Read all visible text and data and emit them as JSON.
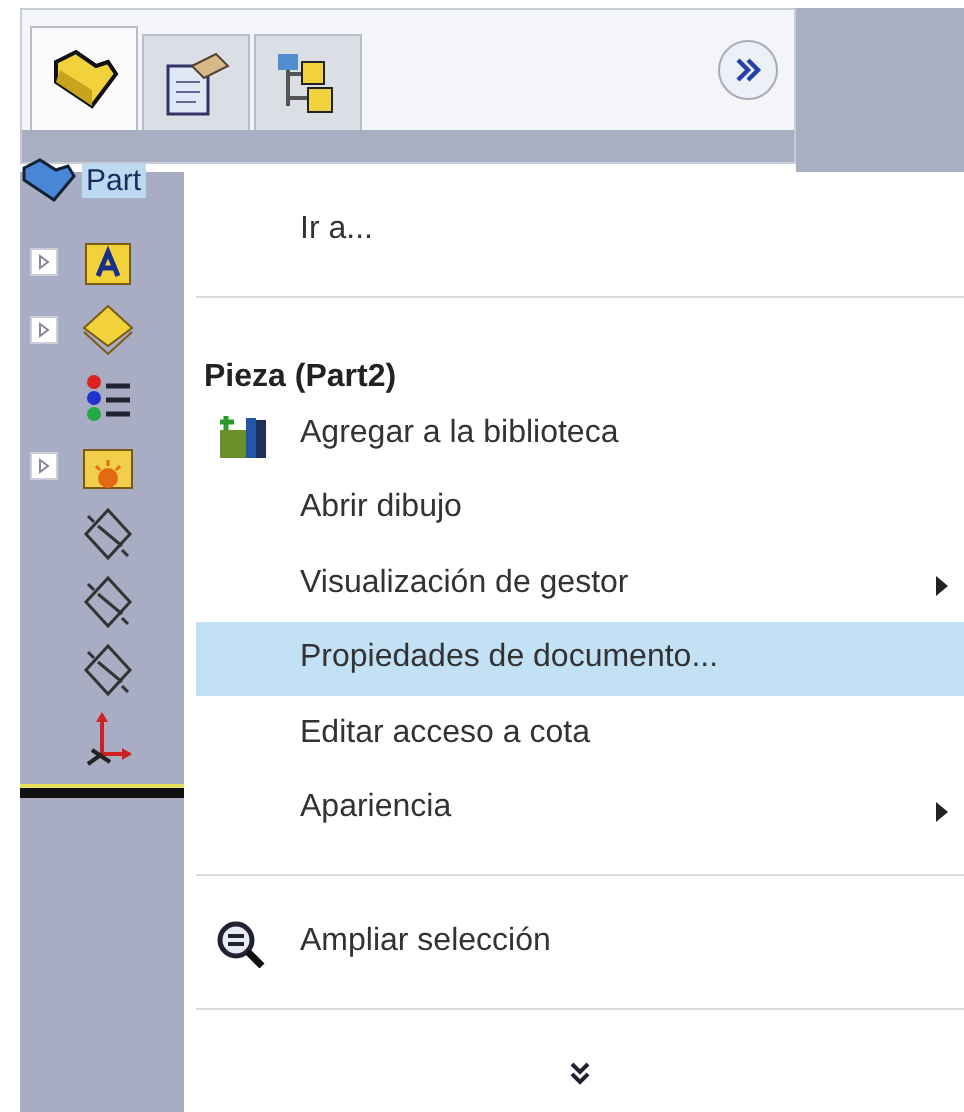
{
  "tabs": [
    {
      "selected": true
    },
    {
      "selected": false
    },
    {
      "selected": false
    }
  ],
  "tree": {
    "root": {
      "label": "Part"
    },
    "items": [
      {
        "expandable": true
      },
      {
        "expandable": true
      },
      {
        "expandable": false
      },
      {
        "expandable": true
      },
      {
        "expandable": false
      },
      {
        "expandable": false
      },
      {
        "expandable": false
      },
      {
        "expandable": false
      }
    ]
  },
  "menu": {
    "items": [
      {
        "kind": "item",
        "label": "Ir a...",
        "selected": false,
        "submenu": false,
        "has_icon": false
      },
      {
        "kind": "divider"
      },
      {
        "kind": "header",
        "label": "Pieza (Part2)"
      },
      {
        "kind": "item",
        "label": "Agregar a la biblioteca",
        "selected": false,
        "submenu": false,
        "has_icon": true
      },
      {
        "kind": "item",
        "label": "Abrir dibujo",
        "selected": false,
        "submenu": false,
        "has_icon": false
      },
      {
        "kind": "item",
        "label": "Visualización de gestor",
        "selected": false,
        "submenu": true,
        "has_icon": false
      },
      {
        "kind": "item",
        "label": "Propiedades de documento...",
        "selected": true,
        "submenu": false,
        "has_icon": false
      },
      {
        "kind": "item",
        "label": "Editar acceso a cota",
        "selected": false,
        "submenu": false,
        "has_icon": false
      },
      {
        "kind": "item",
        "label": "Apariencia",
        "selected": false,
        "submenu": true,
        "has_icon": false
      },
      {
        "kind": "divider"
      },
      {
        "kind": "item",
        "label": "Ampliar selección",
        "selected": false,
        "submenu": false,
        "has_icon": true
      },
      {
        "kind": "divider"
      },
      {
        "kind": "more"
      }
    ]
  }
}
